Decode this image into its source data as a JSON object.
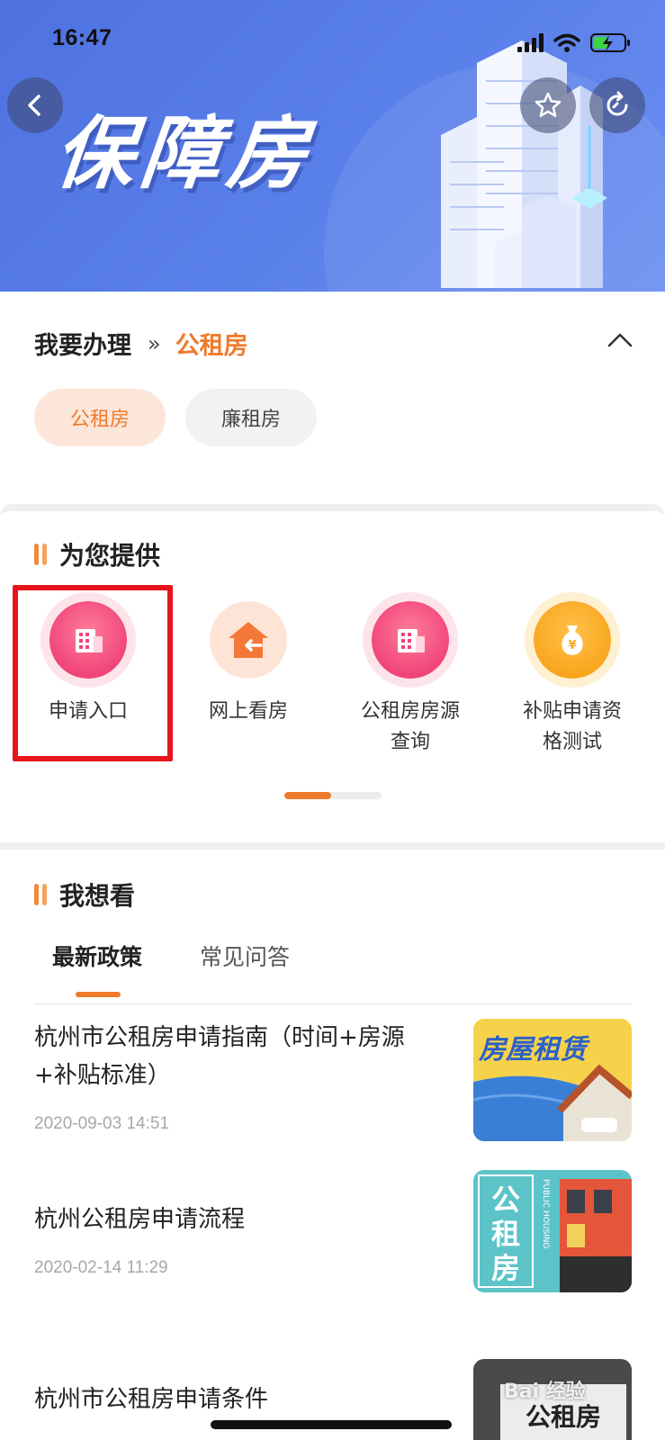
{
  "status_bar": {
    "time": "16:47"
  },
  "banner": {
    "title": "保障房"
  },
  "section_handle": {
    "label": "我要办理",
    "separator": "»",
    "current": "公租房",
    "chips": [
      "公租房",
      "廉租房"
    ]
  },
  "section_services": {
    "title": "为您提供",
    "items": [
      {
        "label": "申请入口",
        "icon": "building-icon"
      },
      {
        "label": "网上看房",
        "icon": "house-icon"
      },
      {
        "label": "公租房房源\n查询",
        "icon": "building-icon"
      },
      {
        "label": "补贴申请资\n格测试",
        "icon": "money-bag-icon"
      }
    ],
    "pager": {
      "pages": 2,
      "current": 1
    }
  },
  "section_news": {
    "title": "我想看",
    "tabs": [
      "最新政策",
      "常见问答"
    ],
    "items": [
      {
        "title": "杭州市公租房申请指南（时间+房源+补贴标准）",
        "date": "2020-09-03 14:51",
        "thumb_text": "房屋租赁"
      },
      {
        "title": "杭州公租房申请流程",
        "date": "2020-02-14 11:29",
        "thumb_text": "公租房",
        "thumb_subtext": "PUBLIC HOUSING"
      },
      {
        "title": "杭州市公租房申请条件",
        "thumb_text": "公租房"
      }
    ]
  },
  "watermark": "Bai 经验",
  "colors": {
    "accent": "#f07a2c",
    "banner": "#5279e4",
    "highlight": "#e8141c"
  }
}
